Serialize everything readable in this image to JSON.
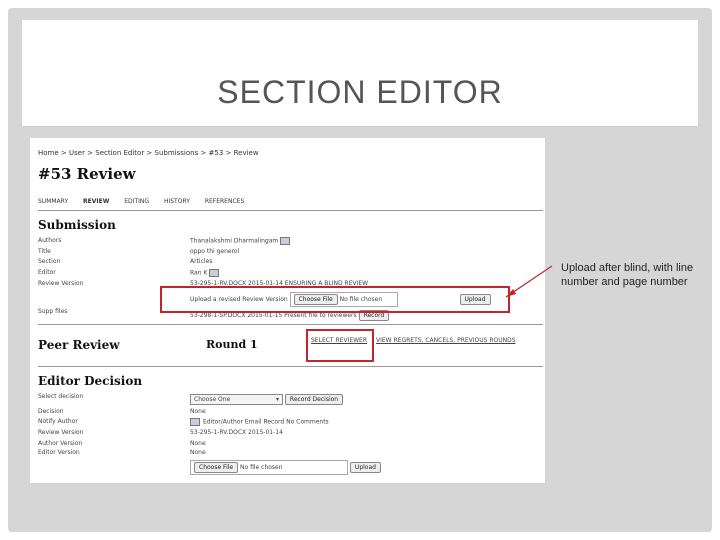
{
  "slide": {
    "title": "SECTION EDITOR"
  },
  "breadcrumb": "Home > User > Section Editor > Submissions > #53 > Review",
  "page_title": "#53 Review",
  "tabs": [
    {
      "label": "SUMMARY",
      "active": false
    },
    {
      "label": "REVIEW",
      "active": true
    },
    {
      "label": "EDITING",
      "active": false
    },
    {
      "label": "HISTORY",
      "active": false
    },
    {
      "label": "REFERENCES",
      "active": false
    }
  ],
  "submission": {
    "heading": "Submission",
    "authors_label": "Authors",
    "authors_value": "Thanalakshmi Dharmalingam",
    "title_label": "Title",
    "title_value": "oppo thi generol",
    "section_label": "Section",
    "section_value": "Articles",
    "editor_label": "Editor",
    "editor_value": "Ran K",
    "review_version_label": "Review Version",
    "review_version_value": "53-295-1-RV.DOCX  2015-01-14   ENSURING A BLIND REVIEW",
    "upload_label": "Upload a revised Review Version",
    "choose_file": "Choose File",
    "no_file": "No file chosen",
    "upload_button": "Upload",
    "supp_label": "Supp files",
    "supp_value": "53-298-1-SP.DOCX  2015-01-15   Present file to reviewers",
    "supp_button": "Record"
  },
  "peer_review": {
    "heading": "Peer Review",
    "round": "Round 1",
    "select_reviewer": "SELECT REVIEWER",
    "other_links": "VIEW REGRETS, CANCELS, PREVIOUS ROUNDS"
  },
  "editor_decision": {
    "heading": "Editor Decision",
    "select_label": "Select decision",
    "select_value": "Choose One",
    "record_button": "Record Decision",
    "decision_label": "Decision",
    "decision_value": "None",
    "notify_label": "Notify Author",
    "notify_value": "Editor/Author Email Record    No Comments",
    "review_version_label": "Review Version",
    "review_version_value": "53-295-1-RV.DOCX  2015-01-14",
    "author_version_label": "Author Version",
    "author_version_value": "None",
    "editor_version_label": "Editor Version",
    "editor_version_value": "None",
    "choose_file": "Choose File",
    "no_file": "No file chosen",
    "upload_button": "Upload"
  },
  "annotation": {
    "note": "Upload after blind, with line number and page number",
    "highlight_color": "#c0262c"
  }
}
